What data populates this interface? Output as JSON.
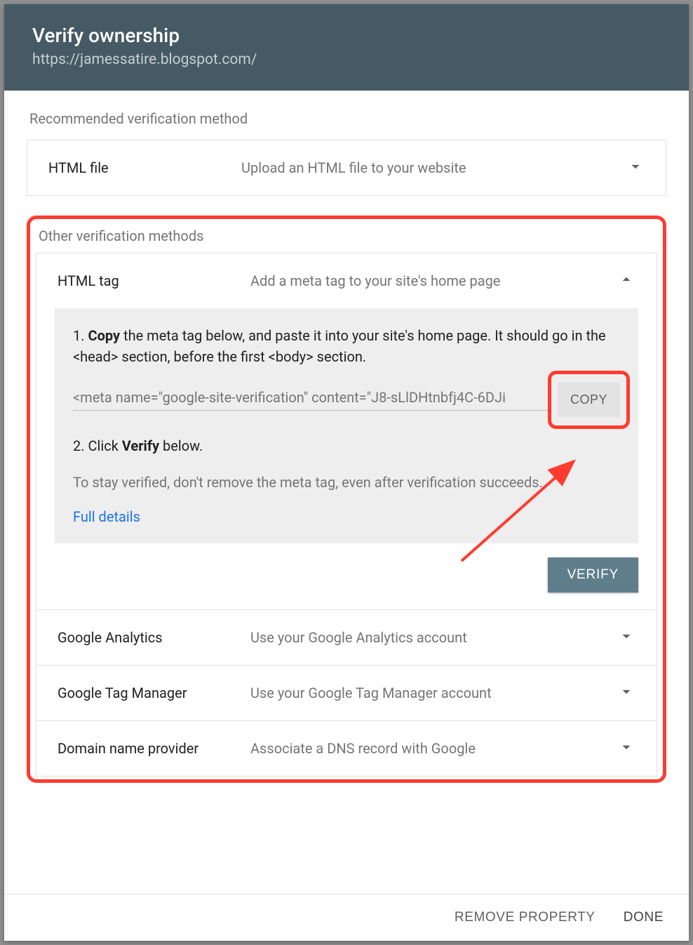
{
  "header": {
    "title": "Verify ownership",
    "subtitle": "https://jamessatire.blogspot.com/"
  },
  "recommended": {
    "heading": "Recommended verification method",
    "method": {
      "name": "HTML file",
      "desc": "Upload an HTML file to your website"
    }
  },
  "other": {
    "heading": "Other verification methods",
    "htmlTag": {
      "name": "HTML tag",
      "desc": "Add a meta tag to your site's home page",
      "step1_prefix": "1. ",
      "step1_bold": "Copy",
      "step1_rest": " the meta tag below, and paste it into your site's home page. It should go in the <head> section, before the first <body> section.",
      "metaTag": "<meta name=\"google-site-verification\" content=\"J8-sLlDHtnbfj4C-6DJi",
      "copyLabel": "COPY",
      "step2_prefix": "2. Click ",
      "step2_bold": "Verify",
      "step2_rest": " below.",
      "note": "To stay verified, don't remove the meta tag, even after verification succeeds.",
      "fullDetails": "Full details",
      "verifyLabel": "VERIFY"
    },
    "methods": [
      {
        "name": "Google Analytics",
        "desc": "Use your Google Analytics account"
      },
      {
        "name": "Google Tag Manager",
        "desc": "Use your Google Tag Manager account"
      },
      {
        "name": "Domain name provider",
        "desc": "Associate a DNS record with Google"
      }
    ]
  },
  "footer": {
    "remove": "REMOVE PROPERTY",
    "done": "DONE"
  }
}
